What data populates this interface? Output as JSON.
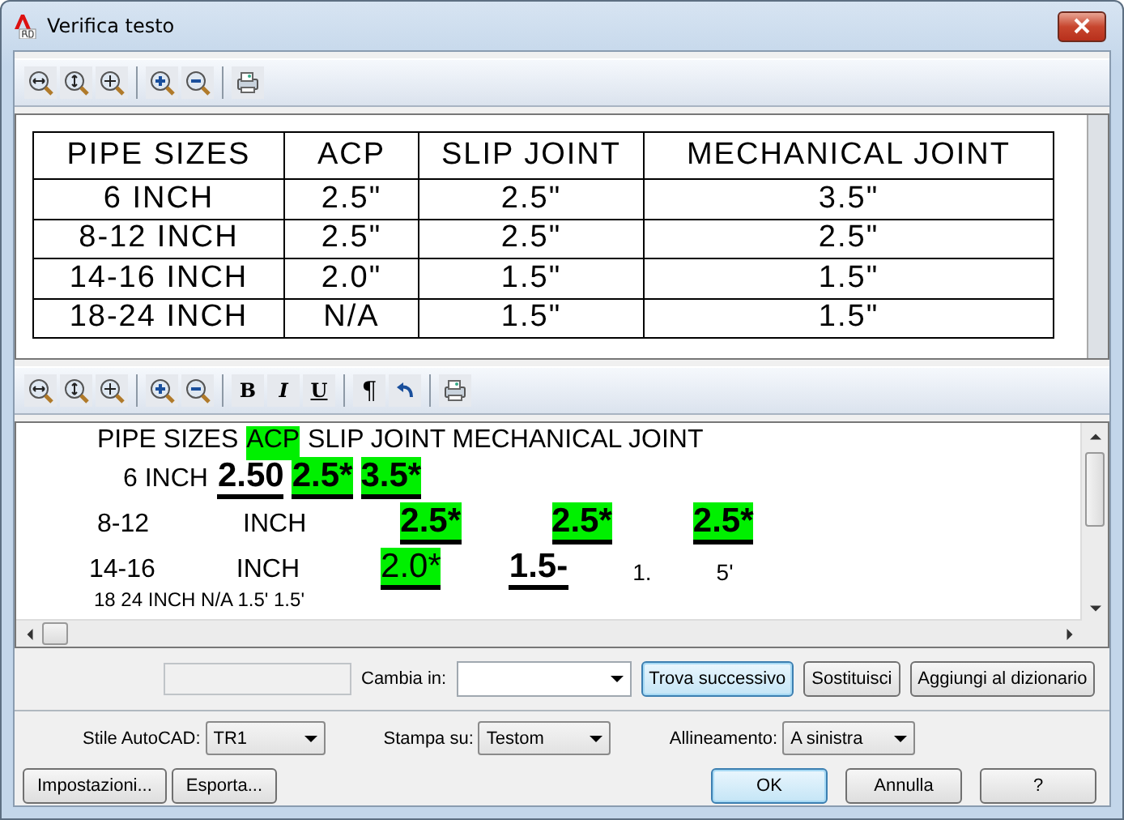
{
  "window": {
    "title": "Verifica testo"
  },
  "preview_table": {
    "columns": [
      "PIPE SIZES",
      "ACP",
      "SLIP JOINT",
      "MECHANICAL JOINT"
    ],
    "rows": [
      [
        "6 INCH",
        "2.5\"",
        "2.5\"",
        "3.5\""
      ],
      [
        "8-12 INCH",
        "2.5\"",
        "2.5\"",
        "2.5\""
      ],
      [
        "14-16 INCH",
        "2.0\"",
        "1.5\"",
        "1.5\""
      ],
      [
        "18-24 INCH",
        "N/A",
        "1.5\"",
        "1.5\""
      ]
    ]
  },
  "format_buttons": [
    "B",
    "I",
    "U",
    "¶"
  ],
  "editor": {
    "lines": [
      [
        {
          "text": "PIPE SIZES",
          "kind": "normal",
          "bold": false,
          "highlighted": false,
          "underlined": false
        },
        {
          "text": "ACP",
          "kind": "normal",
          "bold": false,
          "highlighted": true,
          "underlined": false
        },
        {
          "text": "SLIP JOINT MECHANICAL JOINT",
          "kind": "normal",
          "bold": false,
          "highlighted": false,
          "underlined": false
        }
      ],
      [
        {
          "text": "6 INCH",
          "kind": "normal",
          "bold": false,
          "highlighted": false,
          "underlined": false
        },
        {
          "text": "2.50",
          "kind": "large",
          "bold": true,
          "highlighted": false,
          "underlined": true
        },
        {
          "text": "2.5*",
          "kind": "large",
          "bold": true,
          "highlighted": true,
          "underlined": true
        },
        {
          "text": "3.5*",
          "kind": "large",
          "bold": true,
          "highlighted": true,
          "underlined": true
        }
      ],
      [
        {
          "text": "8-12",
          "kind": "normal",
          "bold": false,
          "highlighted": false,
          "underlined": false
        },
        {
          "text": "INCH",
          "kind": "normal",
          "bold": false,
          "highlighted": false,
          "underlined": false
        },
        {
          "text": "2.5*",
          "kind": "large",
          "bold": true,
          "highlighted": true,
          "underlined": true
        },
        {
          "text": "2.5*",
          "kind": "large",
          "bold": true,
          "highlighted": true,
          "underlined": true
        },
        {
          "text": "2.5*",
          "kind": "large",
          "bold": true,
          "highlighted": true,
          "underlined": true
        }
      ],
      [
        {
          "text": "14-16",
          "kind": "normal",
          "bold": false,
          "highlighted": false,
          "underlined": false
        },
        {
          "text": "INCH",
          "kind": "normal",
          "bold": false,
          "highlighted": false,
          "underlined": false
        },
        {
          "text": "2.0*",
          "kind": "large",
          "bold": false,
          "highlighted": true,
          "underlined": true
        },
        {
          "text": "1.5-",
          "kind": "large",
          "bold": true,
          "highlighted": false,
          "underlined": true
        },
        {
          "text": "1.",
          "kind": "small",
          "bold": false,
          "highlighted": false,
          "underlined": false
        },
        {
          "text": "5'",
          "kind": "small",
          "bold": false,
          "highlighted": false,
          "underlined": false
        }
      ],
      [
        {
          "text": "18 24 INCH N/A 1.5' 1.5'",
          "kind": "small",
          "bold": false,
          "highlighted": false,
          "underlined": false
        }
      ]
    ]
  },
  "find_row": {
    "word_field": {
      "disabled": true
    },
    "change_label": "Cambia in:",
    "buttons": [
      {
        "label": "Trova successivo",
        "focused": true
      },
      {
        "label": "Sostituisci",
        "focused": false
      },
      {
        "label": "Aggiungi al dizionario",
        "focused": false
      }
    ]
  },
  "options": [
    {
      "label": "Stile AutoCAD:",
      "value": "TR1"
    },
    {
      "label": "Stampa su:",
      "value": "Testom"
    },
    {
      "label": "Allineamento:",
      "value": "A sinistra"
    }
  ],
  "left_buttons": [
    "Impostazioni...",
    "Esporta..."
  ],
  "right_buttons": [
    {
      "label": "OK",
      "default": true
    },
    {
      "label": "Annulla",
      "default": false
    },
    {
      "label": "?",
      "default": false
    }
  ]
}
